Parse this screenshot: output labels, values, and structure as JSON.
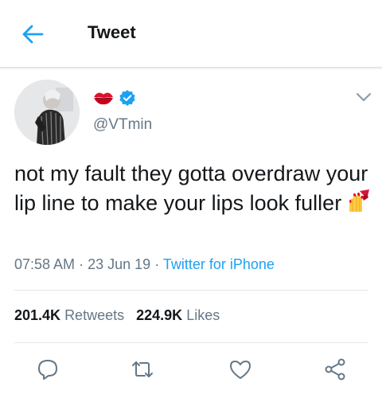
{
  "header": {
    "title": "Tweet"
  },
  "author": {
    "handle": "@VTmin"
  },
  "tweet": {
    "text": "not my fault they gotta overdraw your lip line to make your lips look fuller",
    "time": "07:58 AM",
    "date": "23 Jun 19",
    "separator": "·",
    "source": "Twitter for iPhone"
  },
  "stats": {
    "retweets_count": "201.4K",
    "retweets_label": "Retweets",
    "likes_count": "224.9K",
    "likes_label": "Likes"
  },
  "icons": {
    "back": "back-arrow-icon",
    "name_emoji": "kiss-mark-icon",
    "verified": "verified-badge-icon",
    "more": "chevron-down-icon",
    "nail_polish": "nail-polish-emoji",
    "reply": "reply-icon",
    "retweet": "retweet-icon",
    "like": "heart-icon",
    "share": "share-icon"
  },
  "colors": {
    "accent": "#1da1f2",
    "text": "#14171a",
    "secondary": "#657786",
    "divider": "#e1e8ed",
    "verified": "#1da1f2",
    "lips": "#d0021b"
  }
}
